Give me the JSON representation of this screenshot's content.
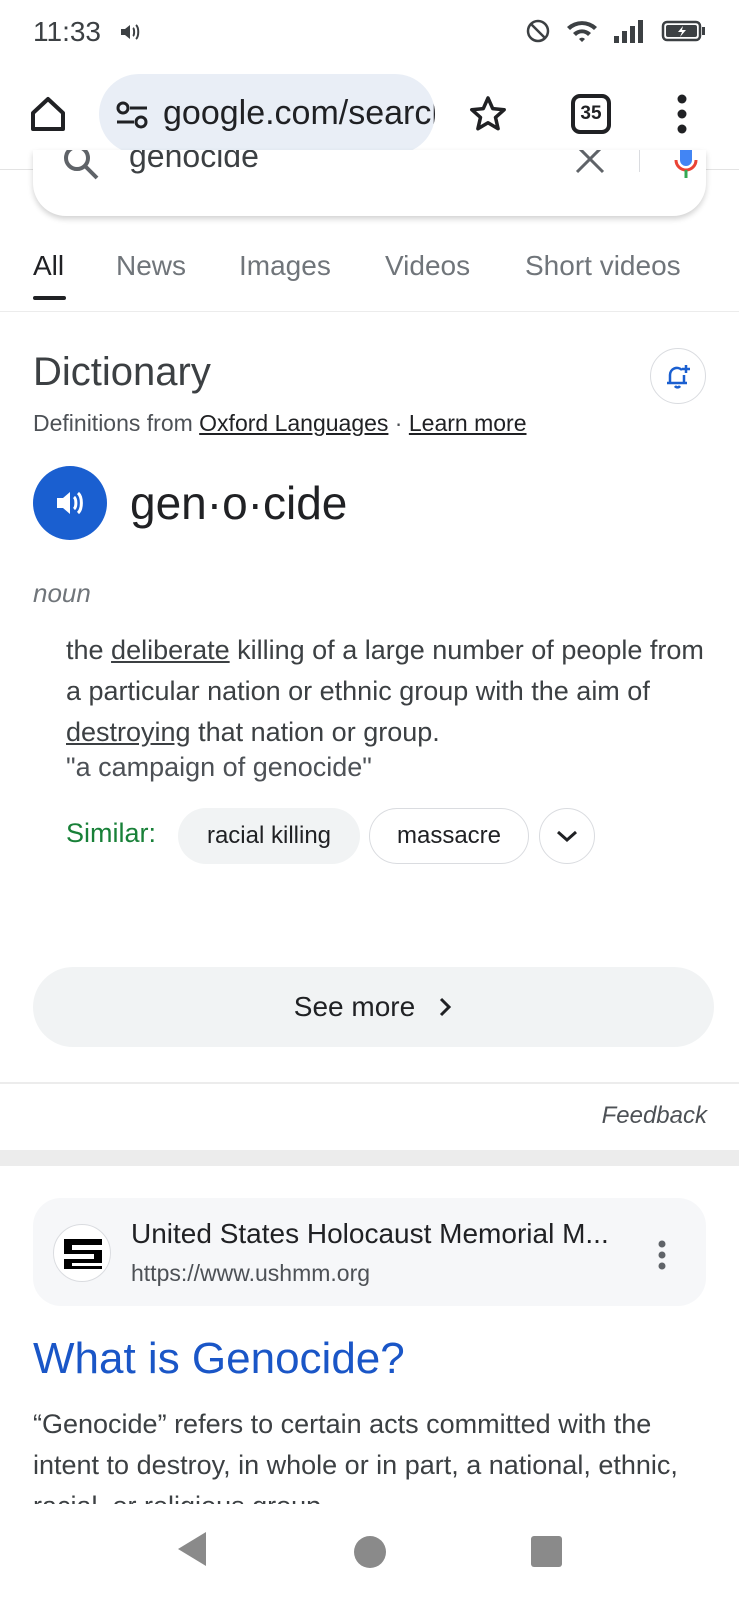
{
  "status_bar": {
    "time": "11:33",
    "icons": [
      "sound-icon",
      "dnd-icon",
      "wifi-icon",
      "signal-icon",
      "battery-charging-icon"
    ]
  },
  "browser": {
    "url": "google.com/search",
    "tab_count": "35",
    "icons": [
      "home-icon",
      "tune-icon",
      "star-icon",
      "more-vert-icon"
    ]
  },
  "search": {
    "query": "genocide",
    "tabs": [
      "All",
      "News",
      "Images",
      "Videos",
      "Short videos"
    ],
    "active_tab": "All"
  },
  "dictionary": {
    "title": "Dictionary",
    "source_prefix": "Definitions from ",
    "source_name": "Oxford Languages",
    "source_separator": " · ",
    "learn_more": "Learn more",
    "headword": "gen·o·cide",
    "part_of_speech": "noun",
    "definition": {
      "p1": "the ",
      "link1": "deliberate",
      "p2": " killing of a large number of people from a particular nation or ethnic group with the aim of ",
      "link2": "destroying",
      "p3": " that nation or group."
    },
    "example": "\"a campaign of genocide\"",
    "similar_label": "Similar:",
    "similar": [
      "racial killing",
      "massacre"
    ],
    "see_more": "See more",
    "feedback": "Feedback"
  },
  "result": {
    "site_name": "United States Holocaust Memorial M...",
    "site_url": "https://www.ushmm.org",
    "title": "What is Genocide?",
    "snippet": "“Genocide” refers to certain acts committed with the intent to destroy, in whole or in part, a national, ethnic, racial, or religious group."
  },
  "colors": {
    "link_blue": "#1a56c7",
    "accent_blue": "#1a5fd0",
    "similar_green": "#188038",
    "pill_bg": "#e9eef6"
  }
}
